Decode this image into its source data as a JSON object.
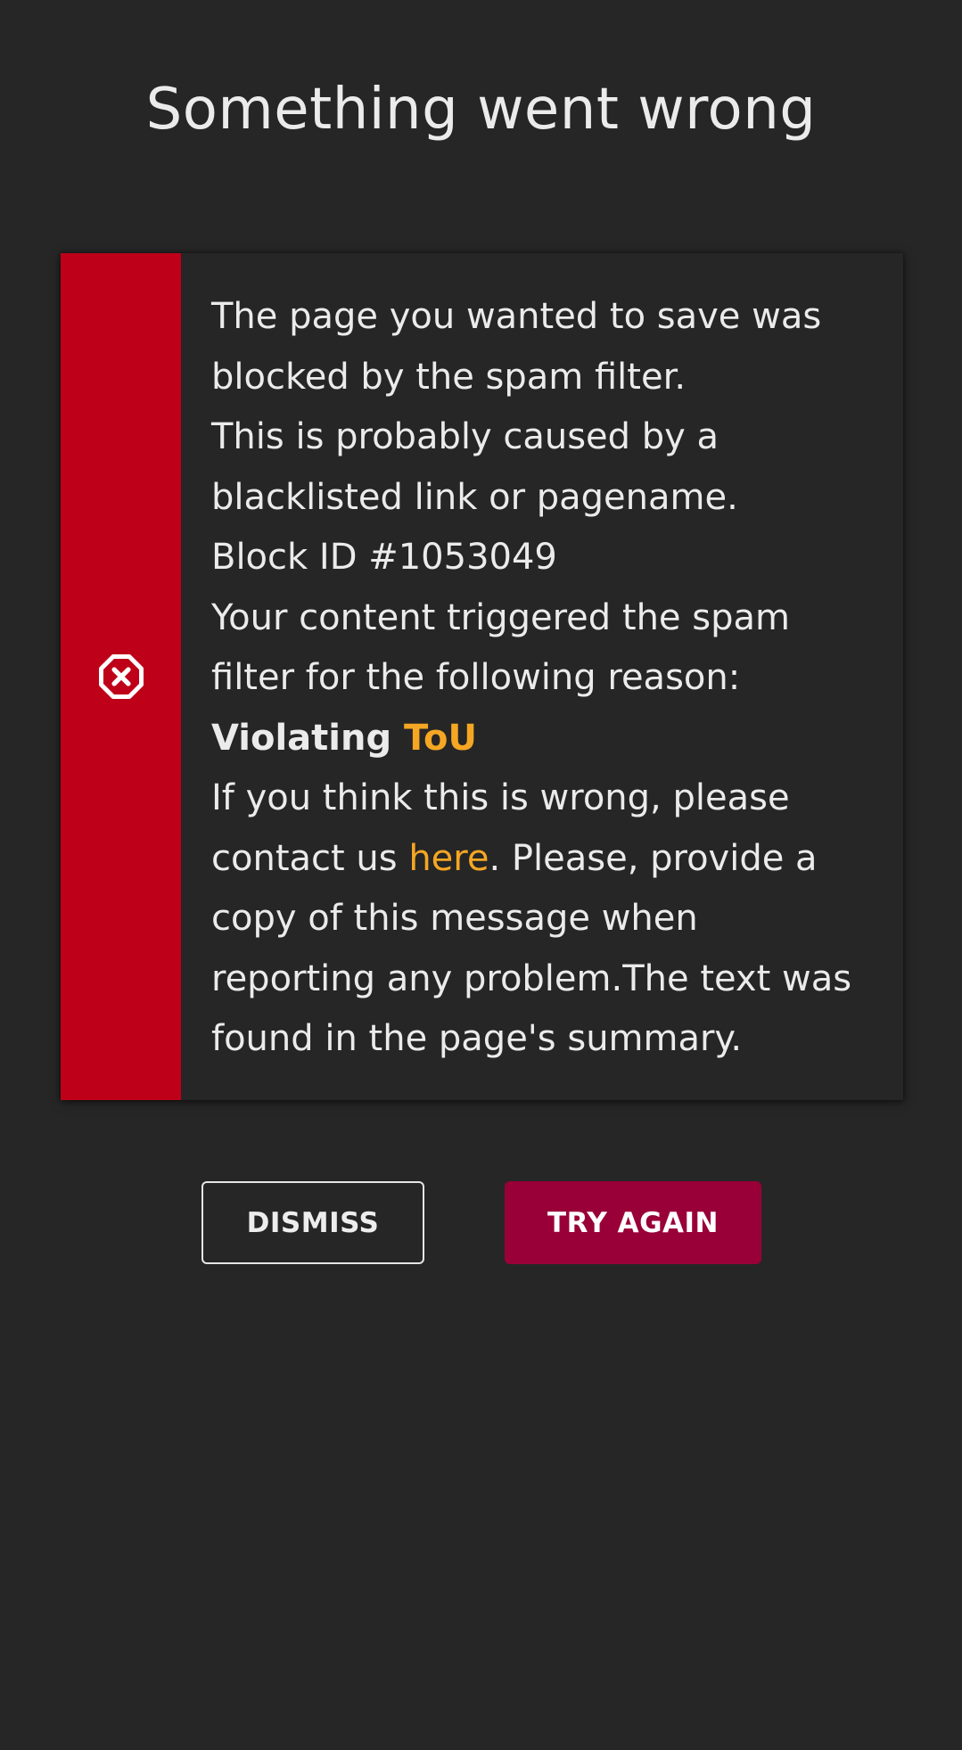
{
  "page": {
    "title": "Something went wrong"
  },
  "alert": {
    "icon": "close-octagon-icon",
    "stripe_color": "#bf0019",
    "line1": "The page you wanted to save was blocked by the spam filter.",
    "line2": "This is probably caused by a blacklisted link or pagename.",
    "block_id": "Block ID #1053049",
    "line3": "Your content triggered the spam filter for the following reason:",
    "reason_prefix": "Violating",
    "reason_link": "ToU",
    "contact_before": "If you think this is wrong, please contact us",
    "contact_link": "here",
    "contact_after": ". Please, provide a copy of this message when reporting any problem.The text was found in the page's summary.",
    "link_color": "#f5a623"
  },
  "buttons": {
    "dismiss_label": "DISMISS",
    "retry_label": "TRY AGAIN",
    "retry_color": "#9a0038"
  }
}
